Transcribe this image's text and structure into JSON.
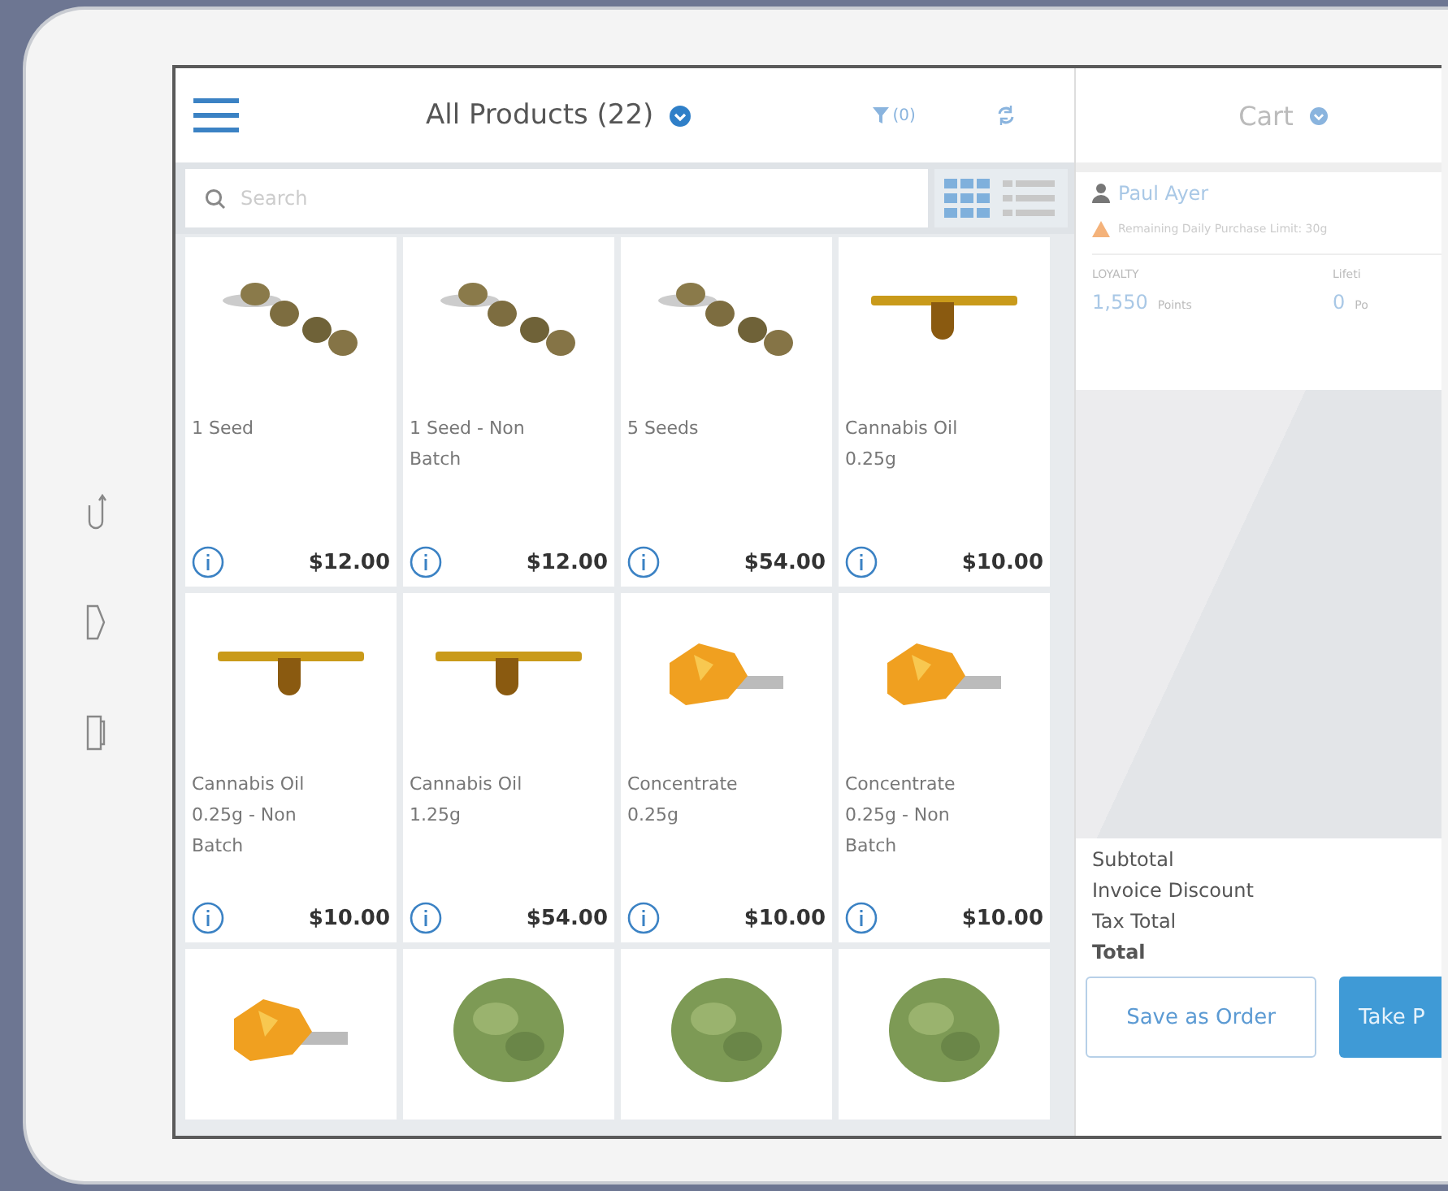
{
  "products_header": {
    "title": "All Products (22)",
    "filter_count": "(0)"
  },
  "search": {
    "placeholder": "Search"
  },
  "products": [
    {
      "name": "1 Seed",
      "price": "$12.00",
      "kind": "seeds"
    },
    {
      "name": "1 Seed - Non Batch",
      "price": "$12.00",
      "kind": "seeds"
    },
    {
      "name": "5 Seeds",
      "price": "$54.00",
      "kind": "seeds"
    },
    {
      "name": "Cannabis Oil 0.25g",
      "price": "$10.00",
      "kind": "oil"
    },
    {
      "name": "Cannabis Oil 0.25g - Non Batch",
      "price": "$10.00",
      "kind": "oil"
    },
    {
      "name": "Cannabis Oil 1.25g",
      "price": "$54.00",
      "kind": "oil"
    },
    {
      "name": "Concentrate 0.25g",
      "price": "$10.00",
      "kind": "concentrate"
    },
    {
      "name": "Concentrate 0.25g - Non Batch",
      "price": "$10.00",
      "kind": "concentrate"
    },
    {
      "kind": "concentrate"
    },
    {
      "kind": "flower"
    },
    {
      "kind": "flower"
    },
    {
      "kind": "flower"
    }
  ],
  "cart": {
    "title": "Cart",
    "customer": "Paul Ayer",
    "limit": "Remaining Daily Purchase Limit: 30g",
    "stats": [
      {
        "label": "LOYALTY",
        "value": "1,550",
        "unit": "Points"
      },
      {
        "label": "Lifeti",
        "value": "0",
        "unit": "Po"
      }
    ],
    "totals": [
      {
        "label": "Subtotal",
        "bold": false
      },
      {
        "label": "Invoice Discount",
        "bold": false
      },
      {
        "label": "Tax Total",
        "bold": false
      },
      {
        "label": "Total",
        "bold": true
      }
    ],
    "buttons": [
      {
        "label": "Save as Order",
        "kind": "outline"
      },
      {
        "label": "Take P",
        "kind": "primary"
      }
    ]
  }
}
